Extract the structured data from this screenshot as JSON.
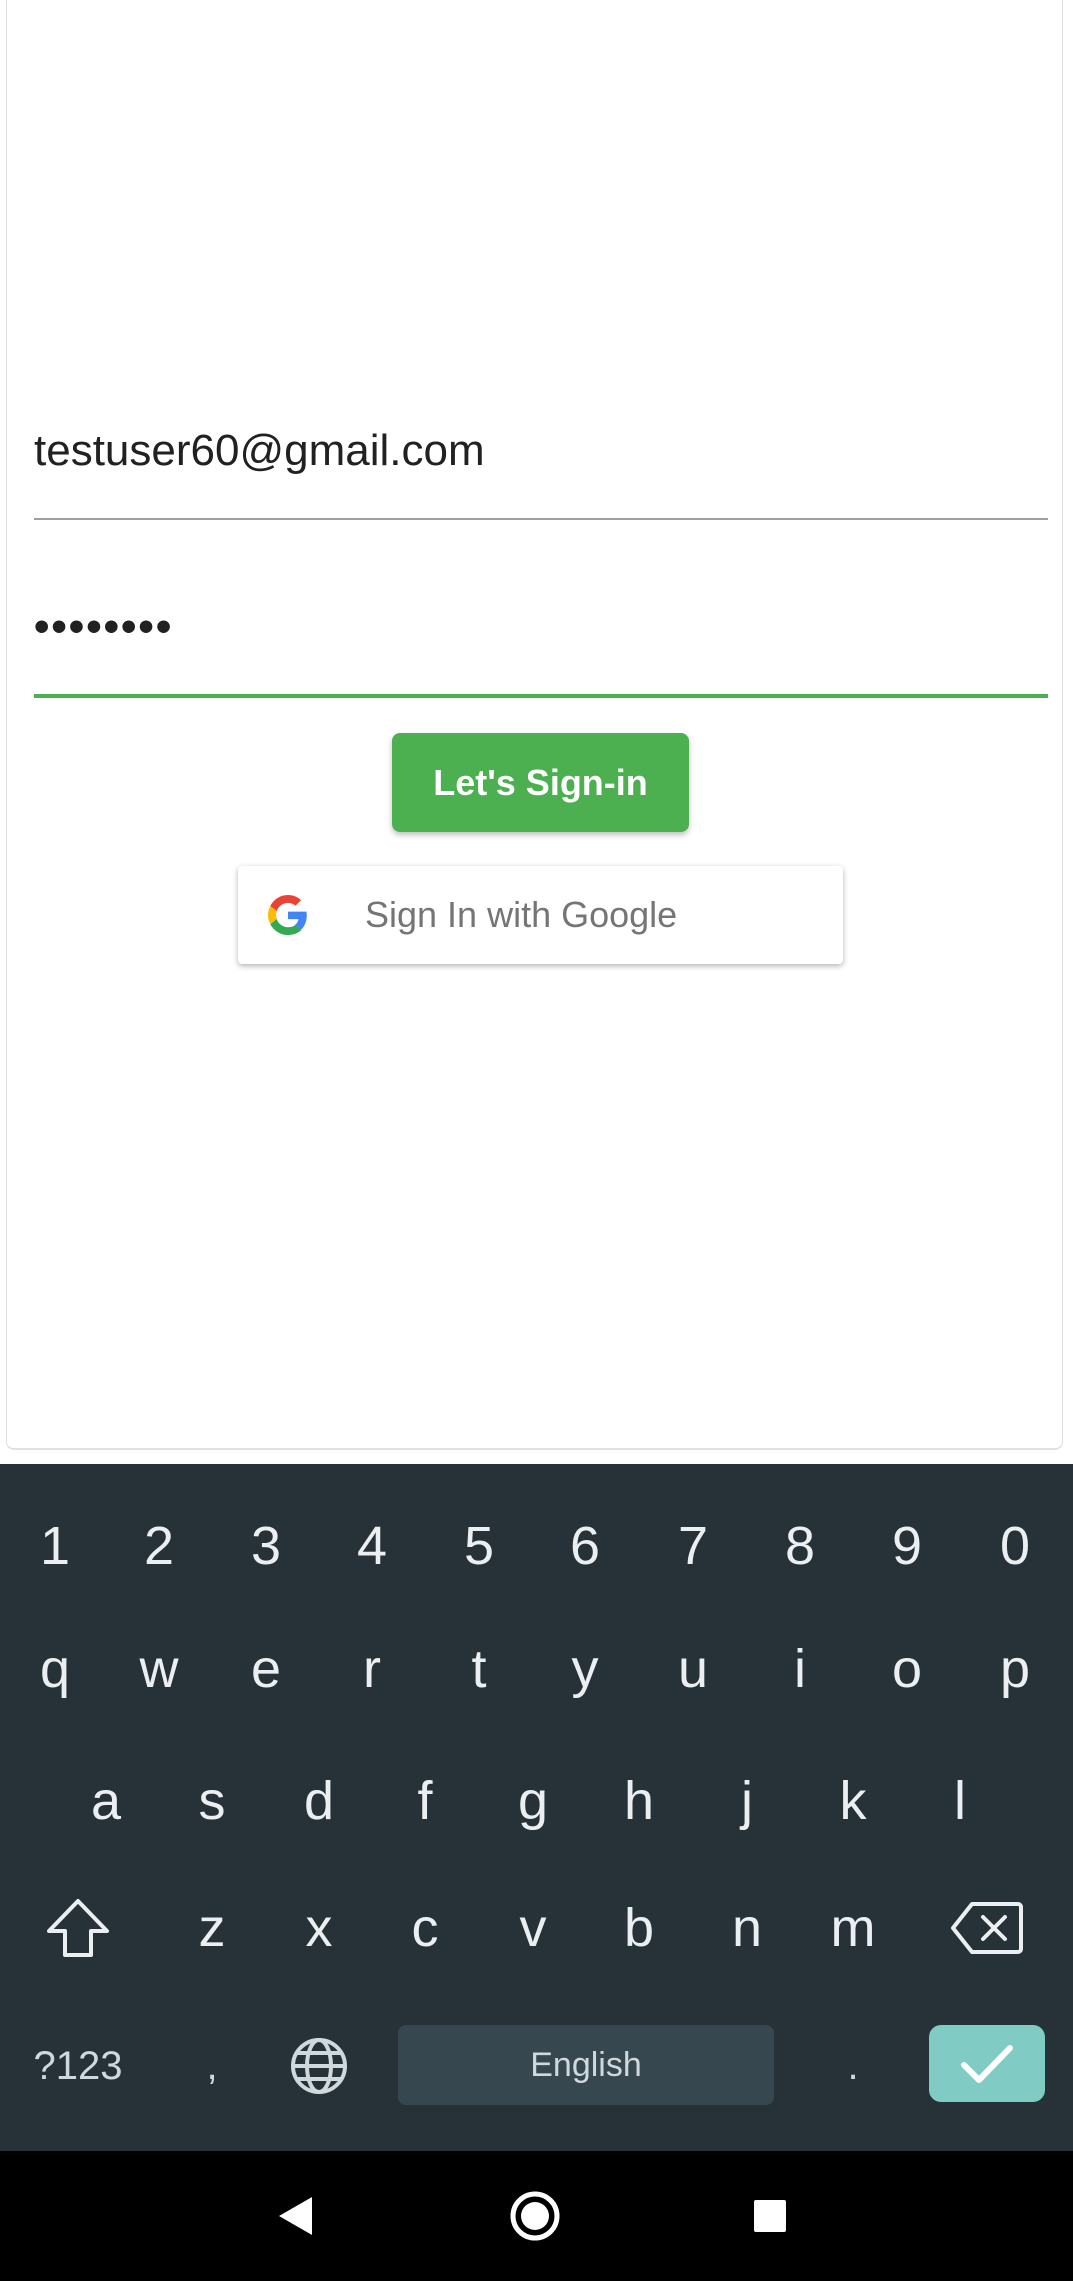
{
  "form": {
    "email_value": "testuser60@gmail.com",
    "password_value": "••••••••",
    "signin_label": "Let's Sign-in",
    "google_label": "Sign In with Google"
  },
  "keyboard": {
    "row_numbers": [
      "1",
      "2",
      "3",
      "4",
      "5",
      "6",
      "7",
      "8",
      "9",
      "0"
    ],
    "row_q": [
      "q",
      "w",
      "e",
      "r",
      "t",
      "y",
      "u",
      "i",
      "o",
      "p"
    ],
    "row_a": [
      "a",
      "s",
      "d",
      "f",
      "g",
      "h",
      "j",
      "k",
      "l"
    ],
    "row_z": [
      "z",
      "x",
      "c",
      "v",
      "b",
      "n",
      "m"
    ],
    "symbols_label": "?123",
    "comma_label": ",",
    "space_label": "English",
    "period_label": "."
  },
  "colors": {
    "accent": "#4caf50",
    "keyboard_bg": "#263238",
    "enter_key": "#80cbc4"
  },
  "icons": {
    "google": "google-icon",
    "shift": "shift-icon",
    "backspace": "backspace-icon",
    "globe": "globe-icon",
    "enter": "check-icon",
    "nav_back": "back-icon",
    "nav_home": "home-icon",
    "nav_recents": "recents-icon"
  }
}
